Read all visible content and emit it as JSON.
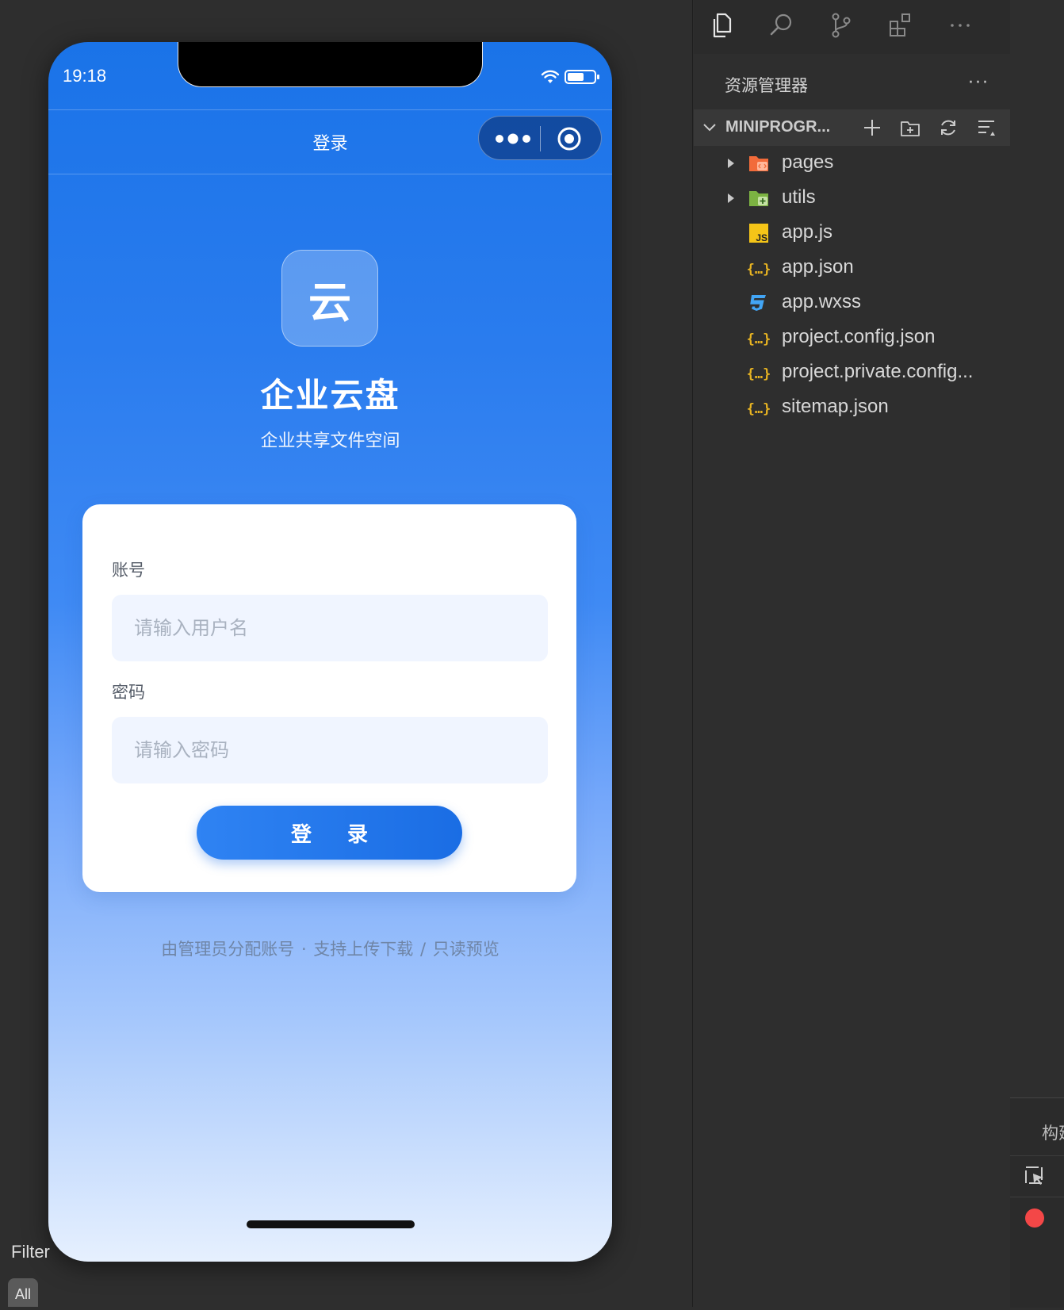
{
  "status_bar": {
    "time": "19:18"
  },
  "nav": {
    "title": "登录"
  },
  "logo": {
    "glyph": "云"
  },
  "app": {
    "name": "企业云盘",
    "subtitle": "企业共享文件空间"
  },
  "form": {
    "account_label": "账号",
    "account_placeholder": "请输入用户名",
    "account_value": "",
    "password_label": "密码",
    "password_placeholder": "请输入密码",
    "password_value": "",
    "submit_label": "登 录"
  },
  "footer_note": "由管理员分配账号 · 支持上传下载 / 只读预览",
  "explorer": {
    "title": "资源管理器",
    "more": "···",
    "project_name": "MINIPROGR...",
    "items": [
      {
        "label": "pages",
        "type": "folder",
        "icon": "folder-pages-icon",
        "color": "#f26b3a"
      },
      {
        "label": "utils",
        "type": "folder",
        "icon": "folder-utils-icon",
        "color": "#7cb342"
      },
      {
        "label": "app.js",
        "type": "file",
        "icon": "js-file-icon",
        "color": "#f5c518"
      },
      {
        "label": "app.json",
        "type": "file",
        "icon": "json-file-icon",
        "color": "#e8b422"
      },
      {
        "label": "app.wxss",
        "type": "file",
        "icon": "css-file-icon",
        "color": "#42a5f5"
      },
      {
        "label": "project.config.json",
        "type": "file",
        "icon": "json-file-icon",
        "color": "#e8b422"
      },
      {
        "label": "project.private.config...",
        "type": "file",
        "icon": "json-file-icon",
        "color": "#e8b422"
      },
      {
        "label": "sitemap.json",
        "type": "file",
        "icon": "json-file-icon",
        "color": "#e8b422"
      }
    ]
  },
  "devtools": {
    "tab_label": "构建",
    "filter_label": "Filter",
    "all_label": "All"
  },
  "colors": {
    "brand_blue": "#1a73e8",
    "input_bg": "#f0f5ff",
    "record_red": "#f44747"
  }
}
